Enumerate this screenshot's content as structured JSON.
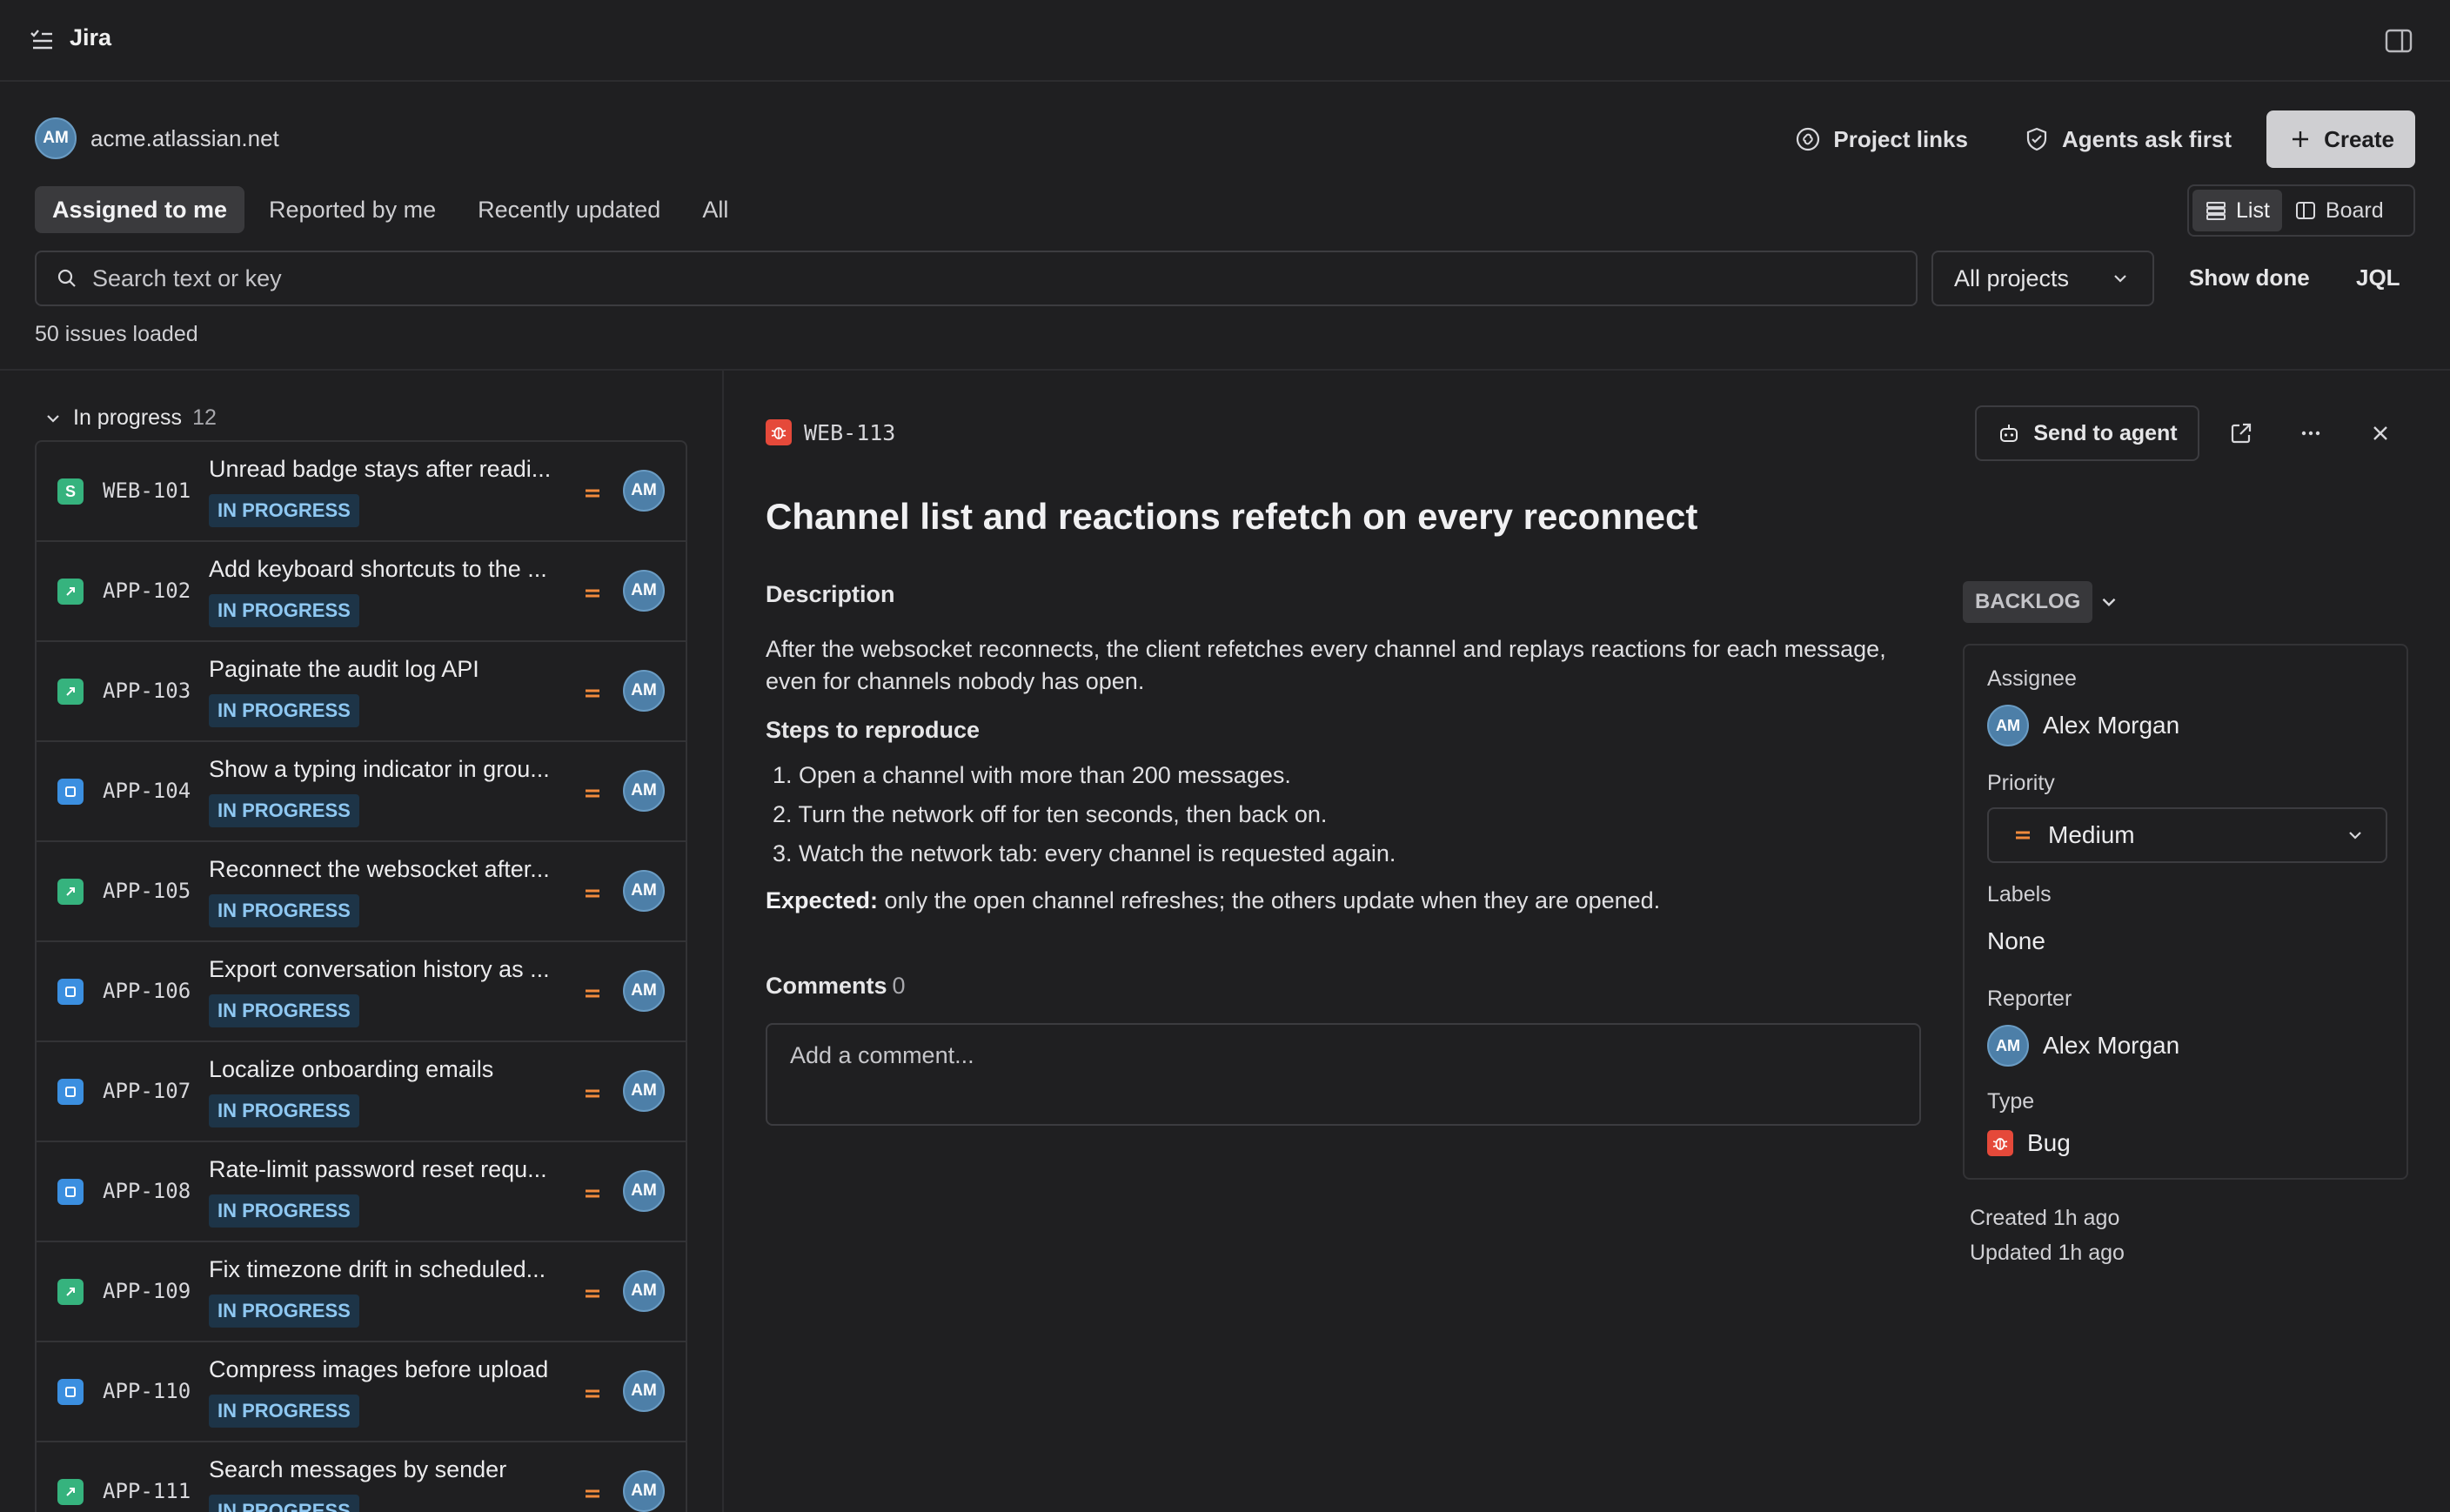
{
  "app": {
    "title": "Jira"
  },
  "site": {
    "avatar": "AM",
    "name": "acme.atlassian.net"
  },
  "header": {
    "project_links": "Project links",
    "agents_ask_first": "Agents ask first",
    "create": "Create"
  },
  "tabs": [
    "Assigned to me",
    "Reported by me",
    "Recently updated",
    "All"
  ],
  "active_tab": "Assigned to me",
  "view": {
    "list": "List",
    "board": "Board",
    "active": "List"
  },
  "search": {
    "placeholder": "Search text or key",
    "value": ""
  },
  "filters": {
    "projects": "All projects",
    "show_done": "Show done",
    "jql": "JQL"
  },
  "issues_loaded": "50 issues loaded",
  "group": {
    "label": "In progress",
    "count": "12"
  },
  "issues": [
    {
      "key": "WEB-101",
      "type": "story",
      "type_letter": "S",
      "summary": "Unread badge stays after readi...",
      "status": "IN PROGRESS",
      "assignee": "AM"
    },
    {
      "key": "APP-102",
      "type": "story",
      "type_letter": "",
      "summary": "Add keyboard shortcuts to the ...",
      "status": "IN PROGRESS",
      "assignee": "AM"
    },
    {
      "key": "APP-103",
      "type": "story",
      "type_letter": "",
      "summary": "Paginate the audit log API",
      "status": "IN PROGRESS",
      "assignee": "AM"
    },
    {
      "key": "APP-104",
      "type": "task",
      "type_letter": "",
      "summary": "Show a typing indicator in grou...",
      "status": "IN PROGRESS",
      "assignee": "AM"
    },
    {
      "key": "APP-105",
      "type": "story",
      "type_letter": "",
      "summary": "Reconnect the websocket after...",
      "status": "IN PROGRESS",
      "assignee": "AM"
    },
    {
      "key": "APP-106",
      "type": "task",
      "type_letter": "",
      "summary": "Export conversation history as ...",
      "status": "IN PROGRESS",
      "assignee": "AM"
    },
    {
      "key": "APP-107",
      "type": "task",
      "type_letter": "",
      "summary": "Localize onboarding emails",
      "status": "IN PROGRESS",
      "assignee": "AM"
    },
    {
      "key": "APP-108",
      "type": "task",
      "type_letter": "",
      "summary": "Rate-limit password reset requ...",
      "status": "IN PROGRESS",
      "assignee": "AM"
    },
    {
      "key": "APP-109",
      "type": "story",
      "type_letter": "",
      "summary": "Fix timezone drift in scheduled...",
      "status": "IN PROGRESS",
      "assignee": "AM"
    },
    {
      "key": "APP-110",
      "type": "task",
      "type_letter": "",
      "summary": "Compress images before upload",
      "status": "IN PROGRESS",
      "assignee": "AM"
    },
    {
      "key": "APP-111",
      "type": "story",
      "type_letter": "",
      "summary": "Search messages by sender",
      "status": "IN PROGRESS",
      "assignee": "AM"
    }
  ],
  "detail": {
    "key": "WEB-113",
    "send_to_agent": "Send to agent",
    "title": "Channel list and reactions refetch on every reconnect",
    "description_heading": "Description",
    "description": "After the websocket reconnects, the client refetches every channel and replays reactions for each message, even for channels nobody has open.",
    "steps_heading": "Steps to reproduce",
    "steps": [
      "1. Open a channel with more than 200 messages.",
      "2. Turn the network off for ten seconds, then back on.",
      "3. Watch the network tab: every channel is requested again."
    ],
    "expected_label": "Expected:",
    "expected_text": " only the open channel refreshes; the others update when they are opened.",
    "comments_label": "Comments",
    "comments_count": "0",
    "comment_placeholder": "Add a comment..."
  },
  "sidebar": {
    "status": "BACKLOG",
    "assignee_label": "Assignee",
    "assignee": "Alex Morgan",
    "assignee_avatar": "AM",
    "priority_label": "Priority",
    "priority": "Medium",
    "labels_label": "Labels",
    "labels": "None",
    "reporter_label": "Reporter",
    "reporter": "Alex Morgan",
    "reporter_avatar": "AM",
    "type_label": "Type",
    "type": "Bug",
    "created": "Created 1h ago",
    "updated": "Updated 1h ago"
  },
  "colors": {
    "background": "#1f1f21",
    "story": "#36b37e",
    "task": "#3b8fe0",
    "bug": "#e5493a",
    "priority_medium": "#f18a3c",
    "status_in_progress_bg": "#1d3447",
    "status_in_progress_fg": "#8fc8f2",
    "avatar": "#4d7fa8"
  },
  "icons": {
    "menu": "list-menu-icon",
    "panel": "panel-toggle-icon",
    "project_links": "link-circle-icon",
    "agents": "shield-icon",
    "create": "plus-icon",
    "search": "search-icon",
    "story": "story-icon",
    "task": "task-icon",
    "bug": "bug-icon",
    "priority_medium": "equals-icon"
  }
}
